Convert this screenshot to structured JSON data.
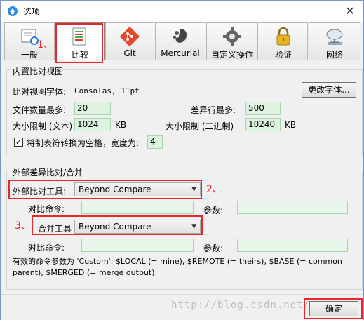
{
  "window": {
    "title": "选项",
    "close_symbol": "✕"
  },
  "toolbar": {
    "items": [
      {
        "label": "一般",
        "icon": "settings-icon"
      },
      {
        "label": "比较",
        "icon": "compare-icon",
        "selected": true
      },
      {
        "label": "Git",
        "icon": "git-icon"
      },
      {
        "label": "Mercurial",
        "icon": "mercurial-icon"
      },
      {
        "label": "自定义操作",
        "icon": "gear-icon"
      },
      {
        "label": "验证",
        "icon": "lock-icon"
      },
      {
        "label": "网络",
        "icon": "network-icon"
      }
    ]
  },
  "annotations": {
    "one": "1、",
    "two": "2、",
    "three": "3、"
  },
  "builtin": {
    "title": "内置比对视图",
    "font_label": "比对视图字体:",
    "font_value": "Consolas, 11pt",
    "change_font_button": "更改字体...",
    "max_files_label": "文件数量最多:",
    "max_files_value": "20",
    "max_diff_label": "差异行最多:",
    "max_diff_value": "500",
    "size_text_label": "大小限制 (文本)",
    "size_text_value": "1024",
    "size_text_unit": "KB",
    "size_bin_label": "大小限制 (二进制)",
    "size_bin_value": "10240",
    "size_bin_unit": "KB",
    "tab_label": "将制表符转换为空格，宽度为:",
    "tab_value": "4",
    "tab_checked": true
  },
  "external": {
    "title": "外部差异比对/合并",
    "diff_tool_label": "外部比对工具:",
    "diff_tool_value": "Beyond Compare",
    "diff_cmd_label": "对比命令:",
    "diff_cmd_value": "",
    "diff_args_label": "参数:",
    "diff_args_value": "",
    "merge_tool_label": "合并工具",
    "merge_tool_value": "Beyond Compare",
    "merge_cmd_label": "对比命令:",
    "merge_cmd_value": "",
    "merge_args_label": "参数:",
    "merge_args_value": "",
    "help_text": "有效的命令参数为 'Custom': $LOCAL (= mine), $REMOTE (= theirs), $BASE (= common parent), $MERGED (= merge output)"
  },
  "footer": {
    "ok_button": "确定",
    "watermark": "http://blog.csdn.net/"
  }
}
